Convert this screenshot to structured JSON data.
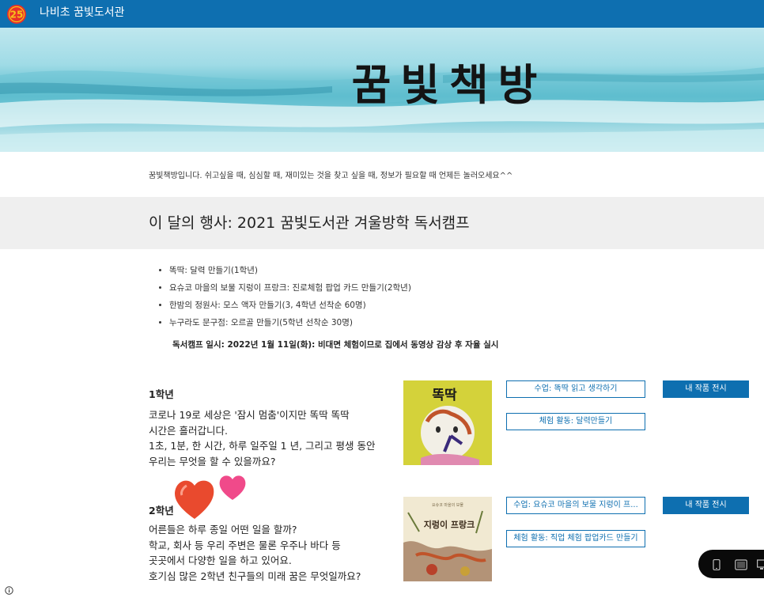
{
  "header": {
    "logo_text": "25",
    "site_title": "나비초 꿈빛도서관"
  },
  "hero": {
    "title": "꿈빛책방"
  },
  "intro_text": "꿈빛책방입니다. 쉬고싶을 때, 심심할 때, 재미있는 것을 찾고 싶을 때, 정보가 필요할 때 언제든 놀러오세요^^",
  "event": {
    "title": "이 달의 행사: 2021 꿈빛도서관 겨울방학 독서캠프",
    "items": [
      "똑딱: 달력 만들기(1학년)",
      "요슈코 마을의 보물 지렁이 프랑크: 진로체험 팝업 카드 만들기(2학년)",
      "한밤의 정원사: 모스 액자 만들기(3, 4학년 선착순 60명)",
      "누구라도 문구점: 오르골 만들기(5학년 선착순 30명)"
    ],
    "camp_date": "독서캠프 일시: 2022년 1월 11일(화): 비대면 체험이므로 집에서 동영상 감상 후 자율 실시"
  },
  "grades": [
    {
      "heading": "1학년",
      "lines": [
        "코로나 19로 세상은 '잠시 멈춤'이지만 똑딱 똑딱",
        "시간은 흘러갑니다.",
        "1초, 1분, 한 시간, 하루 일주일 1 년, 그리고 평생 동안",
        "우리는 무엇을 할 수 있을까요?"
      ],
      "cover_title": "똑딱",
      "buttons": {
        "lesson": "수업: 똑딱 읽고 생각하기",
        "activity": "체험 활동: 달력만들기",
        "gallery": "내 작품 전시"
      }
    },
    {
      "heading": "2학년",
      "lines": [
        "어른들은 하루 종일 어떤 일을 할까?",
        "학교, 회사 등 우리 주변은 물론 우주나 바다 등",
        "곳곳에서 다양한 일을 하고 있어요.",
        "호기심 많은 2학년 친구들의 미래 꿈은 무엇일까요?"
      ],
      "cover_title": "지렁이 프랑크",
      "cover_subtitle": "요슈코 마을의 보물",
      "buttons": {
        "lesson": "수업: 요슈코 마을의 보물 지렁이 프...",
        "activity": "체험 활동: 직업 체험 팝업카드 만들기",
        "gallery": "내 작품 전시"
      }
    }
  ],
  "icons": {
    "info": "info-icon",
    "toolbar": [
      "phone-icon",
      "tablet-icon",
      "desktop-icon"
    ]
  },
  "colors": {
    "brand_blue": "#0e6fb0",
    "band_gray": "#efefef"
  }
}
